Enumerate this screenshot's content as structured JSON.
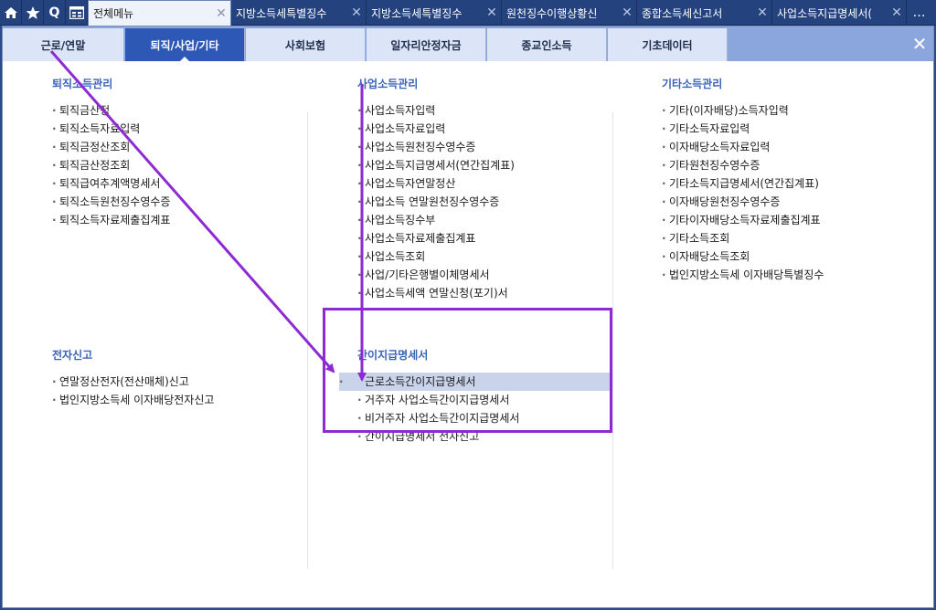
{
  "tabbar": {
    "quick_buttons": [
      {
        "name": "home-icon"
      },
      {
        "name": "star-icon"
      },
      {
        "name": "search-icon",
        "label": "Q"
      },
      {
        "name": "apps-icon"
      }
    ],
    "tabs": [
      {
        "label": "전체메뉴",
        "active": true
      },
      {
        "label": "지방소득세특별징수",
        "active": false
      },
      {
        "label": "지방소득세특별징수",
        "active": false
      },
      {
        "label": "원천징수이행상황신",
        "active": false
      },
      {
        "label": "종합소득세신고서",
        "active": false
      },
      {
        "label": "사업소득지급명세서(",
        "active": false
      }
    ],
    "close_glyph": "✕",
    "more_label": "…"
  },
  "categories": [
    {
      "label": "근로/연말",
      "active": false
    },
    {
      "label": "퇴직/사업/기타",
      "active": true
    },
    {
      "label": "사회보험",
      "active": false
    },
    {
      "label": "일자리안정자금",
      "active": false
    },
    {
      "label": "종교인소득",
      "active": false
    },
    {
      "label": "기초데이터",
      "active": false
    }
  ],
  "close_icon": "✕",
  "sections": {
    "retirement": {
      "title": "퇴직소득관리",
      "items": [
        "퇴직금산정",
        "퇴직소득자료입력",
        "퇴직금정산조회",
        "퇴직금산정조회",
        "퇴직급여추계액명세서",
        "퇴직소득원천징수영수증",
        "퇴직소득자료제출집계표"
      ]
    },
    "business": {
      "title": "사업소득관리",
      "items": [
        "사업소득자입력",
        "사업소득자료입력",
        "사업소득원천징수영수증",
        "사업소득지급명세서(연간집계표)",
        "사업소득자연말정산",
        "사업소득 연말원천징수영수증",
        "사업소득징수부",
        "사업소득자료제출집계표",
        "사업소득조회",
        "사업/기타은행별이체명세서",
        "사업소득세액 연말신청(포기)서"
      ]
    },
    "other": {
      "title": "기타소득관리",
      "items": [
        "기타(이자배당)소득자입력",
        "기타소득자료입력",
        "이자배당소득자료입력",
        "기타원천징수영수증",
        "기타소득지급명세서(연간집계표)",
        "이자배당원천징수영수증",
        "기타이자배당소득자료제출집계표",
        "기타소득조회",
        "이자배당소득조회",
        "법인지방소득세 이자배당특별징수"
      ]
    },
    "efiling": {
      "title": "전자신고",
      "items": [
        "연말정산전자(전산매체)신고",
        "법인지방소득세 이자배당전자신고"
      ]
    },
    "simplified": {
      "title": "간이지급명세서",
      "items": [
        "근로소득간이지급명세서",
        "거주자 사업소득간이지급명세서",
        "비거주자 사업소득간이지급명세서",
        "간이지급명세서 전자신고"
      ],
      "selected_index": 0
    }
  },
  "colors": {
    "active_category": "#2d58b5",
    "category_bar": "#8aa6dc",
    "section_title": "#3a63ba",
    "annotation": "#8d2ad4",
    "selected_row": "#c9d4ea"
  }
}
